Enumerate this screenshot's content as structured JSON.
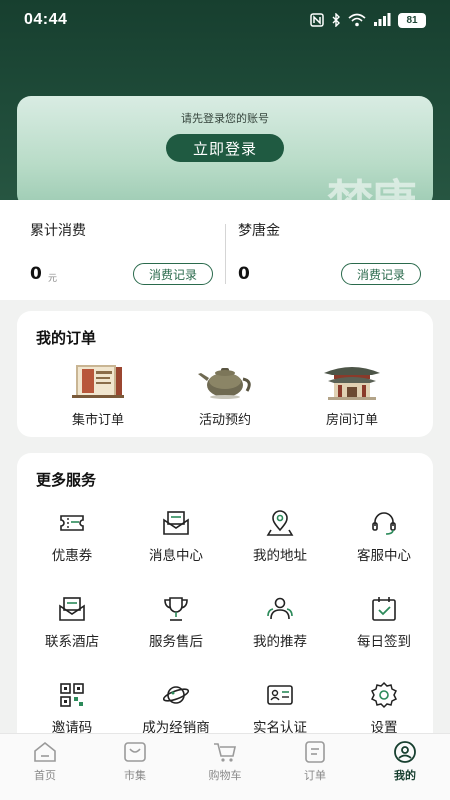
{
  "status": {
    "time": "04:44",
    "battery": "81"
  },
  "login": {
    "hint": "请先登录您的账号",
    "button": "立即登录",
    "watermark": "梦唐"
  },
  "stats": {
    "total_spend": {
      "title": "累计消费",
      "value": "0",
      "unit": "元",
      "button": "消费记录"
    },
    "dream_gold": {
      "title": "梦唐金",
      "value": "0",
      "button": "消费记录"
    }
  },
  "orders": {
    "title": "我的订单",
    "items": [
      {
        "label": "集市订单",
        "icon": "market-order-image"
      },
      {
        "label": "活动预约",
        "icon": "teapot-image"
      },
      {
        "label": "房间订单",
        "icon": "pavilion-image"
      }
    ]
  },
  "services": {
    "title": "更多服务",
    "items": [
      {
        "label": "优惠券",
        "icon": "coupon-icon"
      },
      {
        "label": "消息中心",
        "icon": "message-icon"
      },
      {
        "label": "我的地址",
        "icon": "location-icon"
      },
      {
        "label": "客服中心",
        "icon": "headset-icon"
      },
      {
        "label": "联系酒店",
        "icon": "mail-icon"
      },
      {
        "label": "服务售后",
        "icon": "trophy-icon"
      },
      {
        "label": "我的推荐",
        "icon": "users-icon"
      },
      {
        "label": "每日签到",
        "icon": "calendar-check-icon"
      },
      {
        "label": "邀请码",
        "icon": "qrcode-icon"
      },
      {
        "label": "成为经销商",
        "icon": "planet-icon"
      },
      {
        "label": "实名认证",
        "icon": "id-card-icon"
      },
      {
        "label": "设置",
        "icon": "gear-icon"
      }
    ]
  },
  "tabs": [
    {
      "label": "首页",
      "icon": "home-icon",
      "active": false
    },
    {
      "label": "市集",
      "icon": "market-icon",
      "active": false
    },
    {
      "label": "购物车",
      "icon": "cart-icon",
      "active": false
    },
    {
      "label": "订单",
      "icon": "order-icon",
      "active": false
    },
    {
      "label": "我的",
      "icon": "profile-icon",
      "active": true
    }
  ],
  "colors": {
    "brand_dark": "#173f2f",
    "brand": "#1f5a41",
    "accent_outline": "#2a6a4c"
  }
}
